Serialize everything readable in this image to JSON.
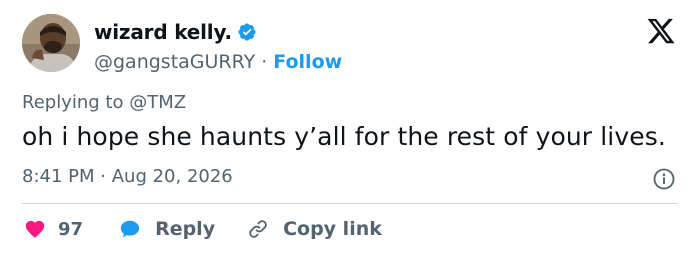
{
  "user": {
    "display_name": "wizard kelly.",
    "handle": "@gangstaGURRY",
    "follow_label": "Follow",
    "separator": "·",
    "verified_icon": "verified-badge-icon",
    "verified_color": "#1d9bf0"
  },
  "reply_context": {
    "prefix": "Replying to",
    "mention": "@TMZ"
  },
  "tweet": {
    "text": "oh i hope she haunts y’all for the rest of your lives.",
    "time": "8:41 PM",
    "separator": "·",
    "date": "Aug 20, 2026"
  },
  "actions": {
    "like_count": "97",
    "like_color": "#f91880",
    "reply_label": "Reply",
    "reply_color": "#1d9bf0",
    "copy_link_label": "Copy link"
  },
  "icons": [
    "x-logo-icon",
    "info-icon",
    "heart-icon",
    "speech-bubble-icon",
    "link-icon"
  ],
  "colors": {
    "text_primary": "#0f1419",
    "text_secondary": "#536471",
    "accent": "#1d9bf0",
    "divider": "#cfd9de"
  }
}
